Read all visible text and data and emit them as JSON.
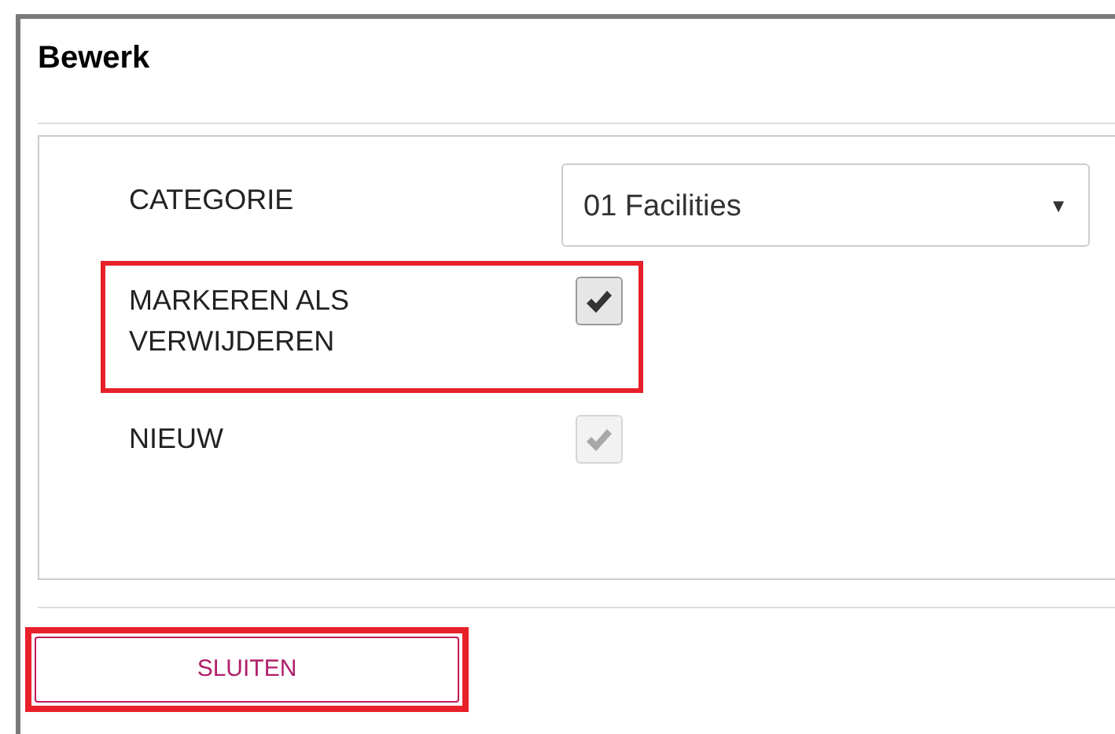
{
  "dialog": {
    "title": "Bewerk"
  },
  "fields": [
    {
      "kind": "select",
      "label": "CATEGORIE",
      "value": "01 Facilities",
      "arrow": "▼"
    },
    {
      "kind": "checkbox",
      "label": "MARKEREN ALS VERWIJDEREN",
      "checked": true,
      "disabled": false,
      "highlighted": true
    },
    {
      "kind": "checkbox",
      "label": "NIEUW",
      "checked": true,
      "disabled": true,
      "highlighted": false
    }
  ],
  "footer": {
    "button": {
      "label": "SLUITEN",
      "highlighted": true
    }
  }
}
